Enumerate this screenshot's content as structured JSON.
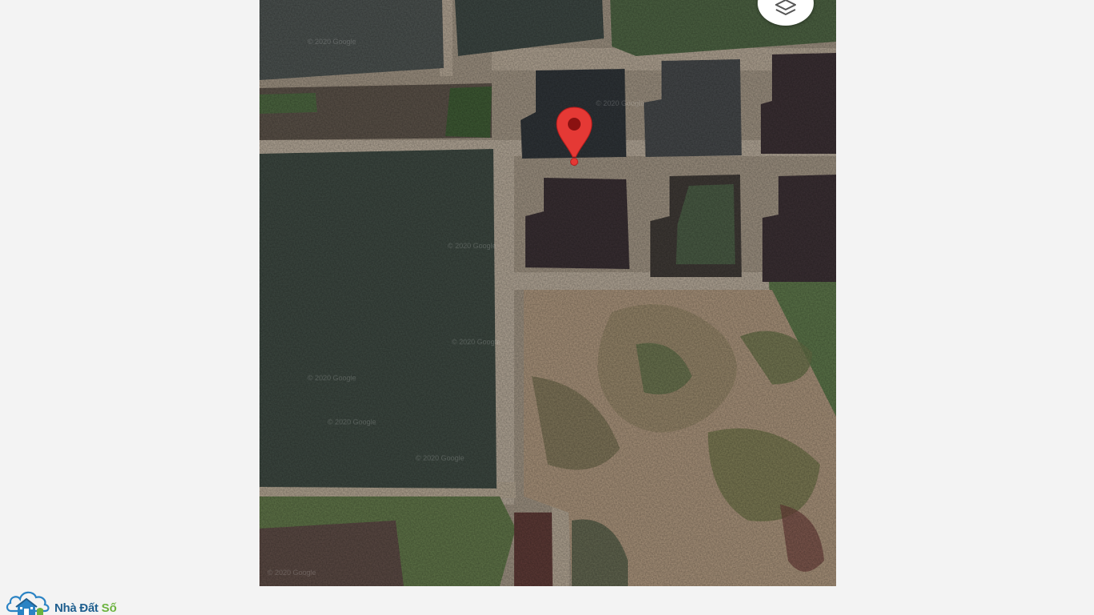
{
  "map": {
    "type": "satellite",
    "attribution_watermark": "© 2020 Google",
    "layers_button_icon": "layers-icon",
    "marker_icon": "map-pin-icon",
    "marker_color": "#e53935"
  },
  "brand": {
    "logo_icon": "house-cloud-icon",
    "name_part1": "Nhà Đất",
    "name_part2": "Số",
    "color_primary": "#1f5f8f",
    "color_accent": "#6cb33f"
  }
}
